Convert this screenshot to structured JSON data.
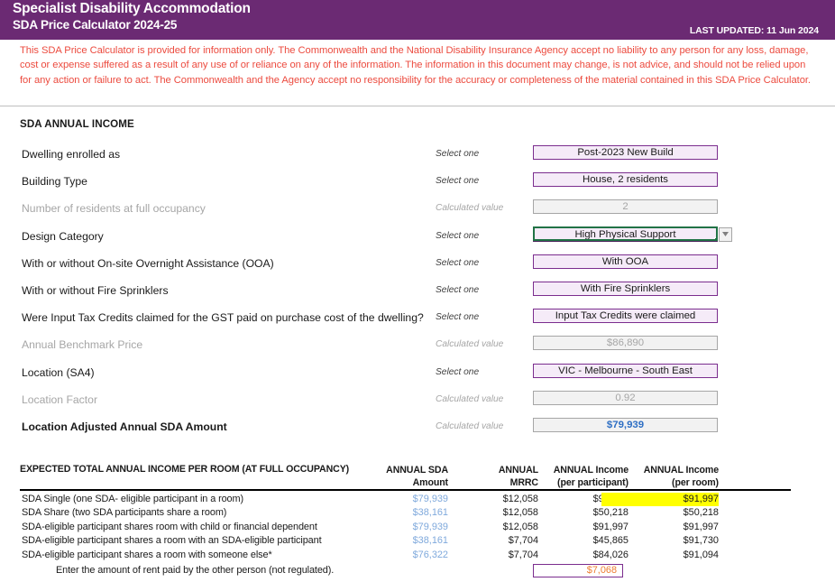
{
  "banner": {
    "title_line1": "Specialist Disability Accommodation",
    "title_line2": "SDA Price Calculator 2024-25",
    "last_updated": "LAST UPDATED: 11 Jun 2024",
    "bg_color": "#6B2A73"
  },
  "disclaimer": {
    "text": "This SDA Price Calculator is provided for information only.  The Commonwealth and the National Disability Insurance Agency accept no liability to any person for any loss, damage, cost or expense suffered as a result of any use of or reliance on any of the information.  The information in this document may change, is not advice, and should not be relied upon for any action or failure to act. The Commonwealth and the Agency accept no responsibility for the accuracy or completeness of the material contained in this SDA Price Calculator.",
    "color": "#EC4B3F"
  },
  "form": {
    "section_heading": "SDA ANNUAL INCOME",
    "hint_select": "Select one",
    "hint_calculated": "Calculated value",
    "rows": [
      {
        "label": "Dwelling enrolled as",
        "hint": "Select one",
        "value": "Post-2023 New Build",
        "kind": "select",
        "muted": false
      },
      {
        "label": "Building Type",
        "hint": "Select one",
        "value": "House, 2 residents",
        "kind": "select",
        "muted": false
      },
      {
        "label": "Number of residents at full occupancy",
        "hint": "Calculated value",
        "value": "2",
        "kind": "calc",
        "muted": true
      },
      {
        "label": "Design Category",
        "hint": "Select one",
        "value": "High Physical Support",
        "kind": "active",
        "muted": false
      },
      {
        "label": "With or without On-site Overnight Assistance (OOA)",
        "hint": "Select one",
        "value": "With OOA",
        "kind": "select",
        "muted": false
      },
      {
        "label": "With or without Fire Sprinklers",
        "hint": "Select one",
        "value": "With Fire Sprinklers",
        "kind": "select",
        "muted": false
      },
      {
        "label": "Were Input Tax Credits claimed for the GST paid on purchase cost of the dwelling?",
        "hint": "Select one",
        "value": "Input Tax Credits were claimed",
        "kind": "select",
        "muted": false
      },
      {
        "label": "Annual Benchmark Price",
        "hint": "Calculated value",
        "value": "$86,890",
        "kind": "calc",
        "muted": true
      },
      {
        "label": "Location (SA4)",
        "hint": "Select one",
        "value": "VIC - Melbourne - South East",
        "kind": "select",
        "muted": false
      },
      {
        "label": "Location Factor",
        "hint": "Calculated value",
        "value": "0.92",
        "kind": "calc",
        "muted": true
      },
      {
        "label": "Location Adjusted Annual SDA Amount",
        "hint": "Calculated value",
        "value": "$79,939",
        "kind": "calc-blue",
        "muted": false
      }
    ],
    "dropdown_icon": "chevron-down-icon"
  },
  "table": {
    "title": "EXPECTED TOTAL ANNUAL INCOME PER ROOM (AT FULL OCCUPANCY)",
    "columns": [
      {
        "line1": "ANNUAL SDA",
        "line2": "Amount"
      },
      {
        "line1": "ANNUAL",
        "line2": "MRRC"
      },
      {
        "line1": "ANNUAL Income",
        "line2": "(per participant)"
      },
      {
        "line1": "ANNUAL Income",
        "line2": "(per room)"
      }
    ],
    "rows": [
      {
        "label": "SDA Single (one SDA- eligible participant in a room)",
        "sda": "$79,939",
        "mrrc": "$12,058",
        "per_participant": "$91,997",
        "per_room": "$91,997",
        "per_room_highlight": true
      },
      {
        "label": "SDA Share (two SDA participants share a room)",
        "sda": "$38,161",
        "mrrc": "$12,058",
        "per_participant": "$50,218",
        "per_room": "$50,218",
        "per_room_highlight": false
      },
      {
        "label": "SDA-eligible participant shares room with child or financial dependent",
        "sda": "$79,939",
        "mrrc": "$12,058",
        "per_participant": "$91,997",
        "per_room": "$91,997",
        "per_room_highlight": false
      },
      {
        "label": "SDA-eligible participant shares a room with an SDA-eligible participant",
        "sda": "$38,161",
        "mrrc": "$7,704",
        "per_participant": "$45,865",
        "per_room": "$91,730",
        "per_room_highlight": false
      },
      {
        "label": "SDA-eligible participant shares a room with someone else*",
        "sda": "$76,322",
        "mrrc": "$7,704",
        "per_participant": "$84,026",
        "per_room": "$91,094",
        "per_room_highlight": false
      }
    ],
    "rent_row": {
      "label": "Enter the amount of rent paid by the other person (not regulated).",
      "value": "$7,068"
    }
  },
  "colors": {
    "purple": "#6B2A73",
    "field_border": "#7B2D8E",
    "field_fill": "#F5EBF8",
    "calc_fill": "#F2F2F2",
    "blue_value": "#2E6FC4",
    "sda_blue": "#7FA9DC",
    "highlight_yellow": "#FFFF00",
    "orange_input": "#ED7D31",
    "excel_green": "#217346"
  }
}
